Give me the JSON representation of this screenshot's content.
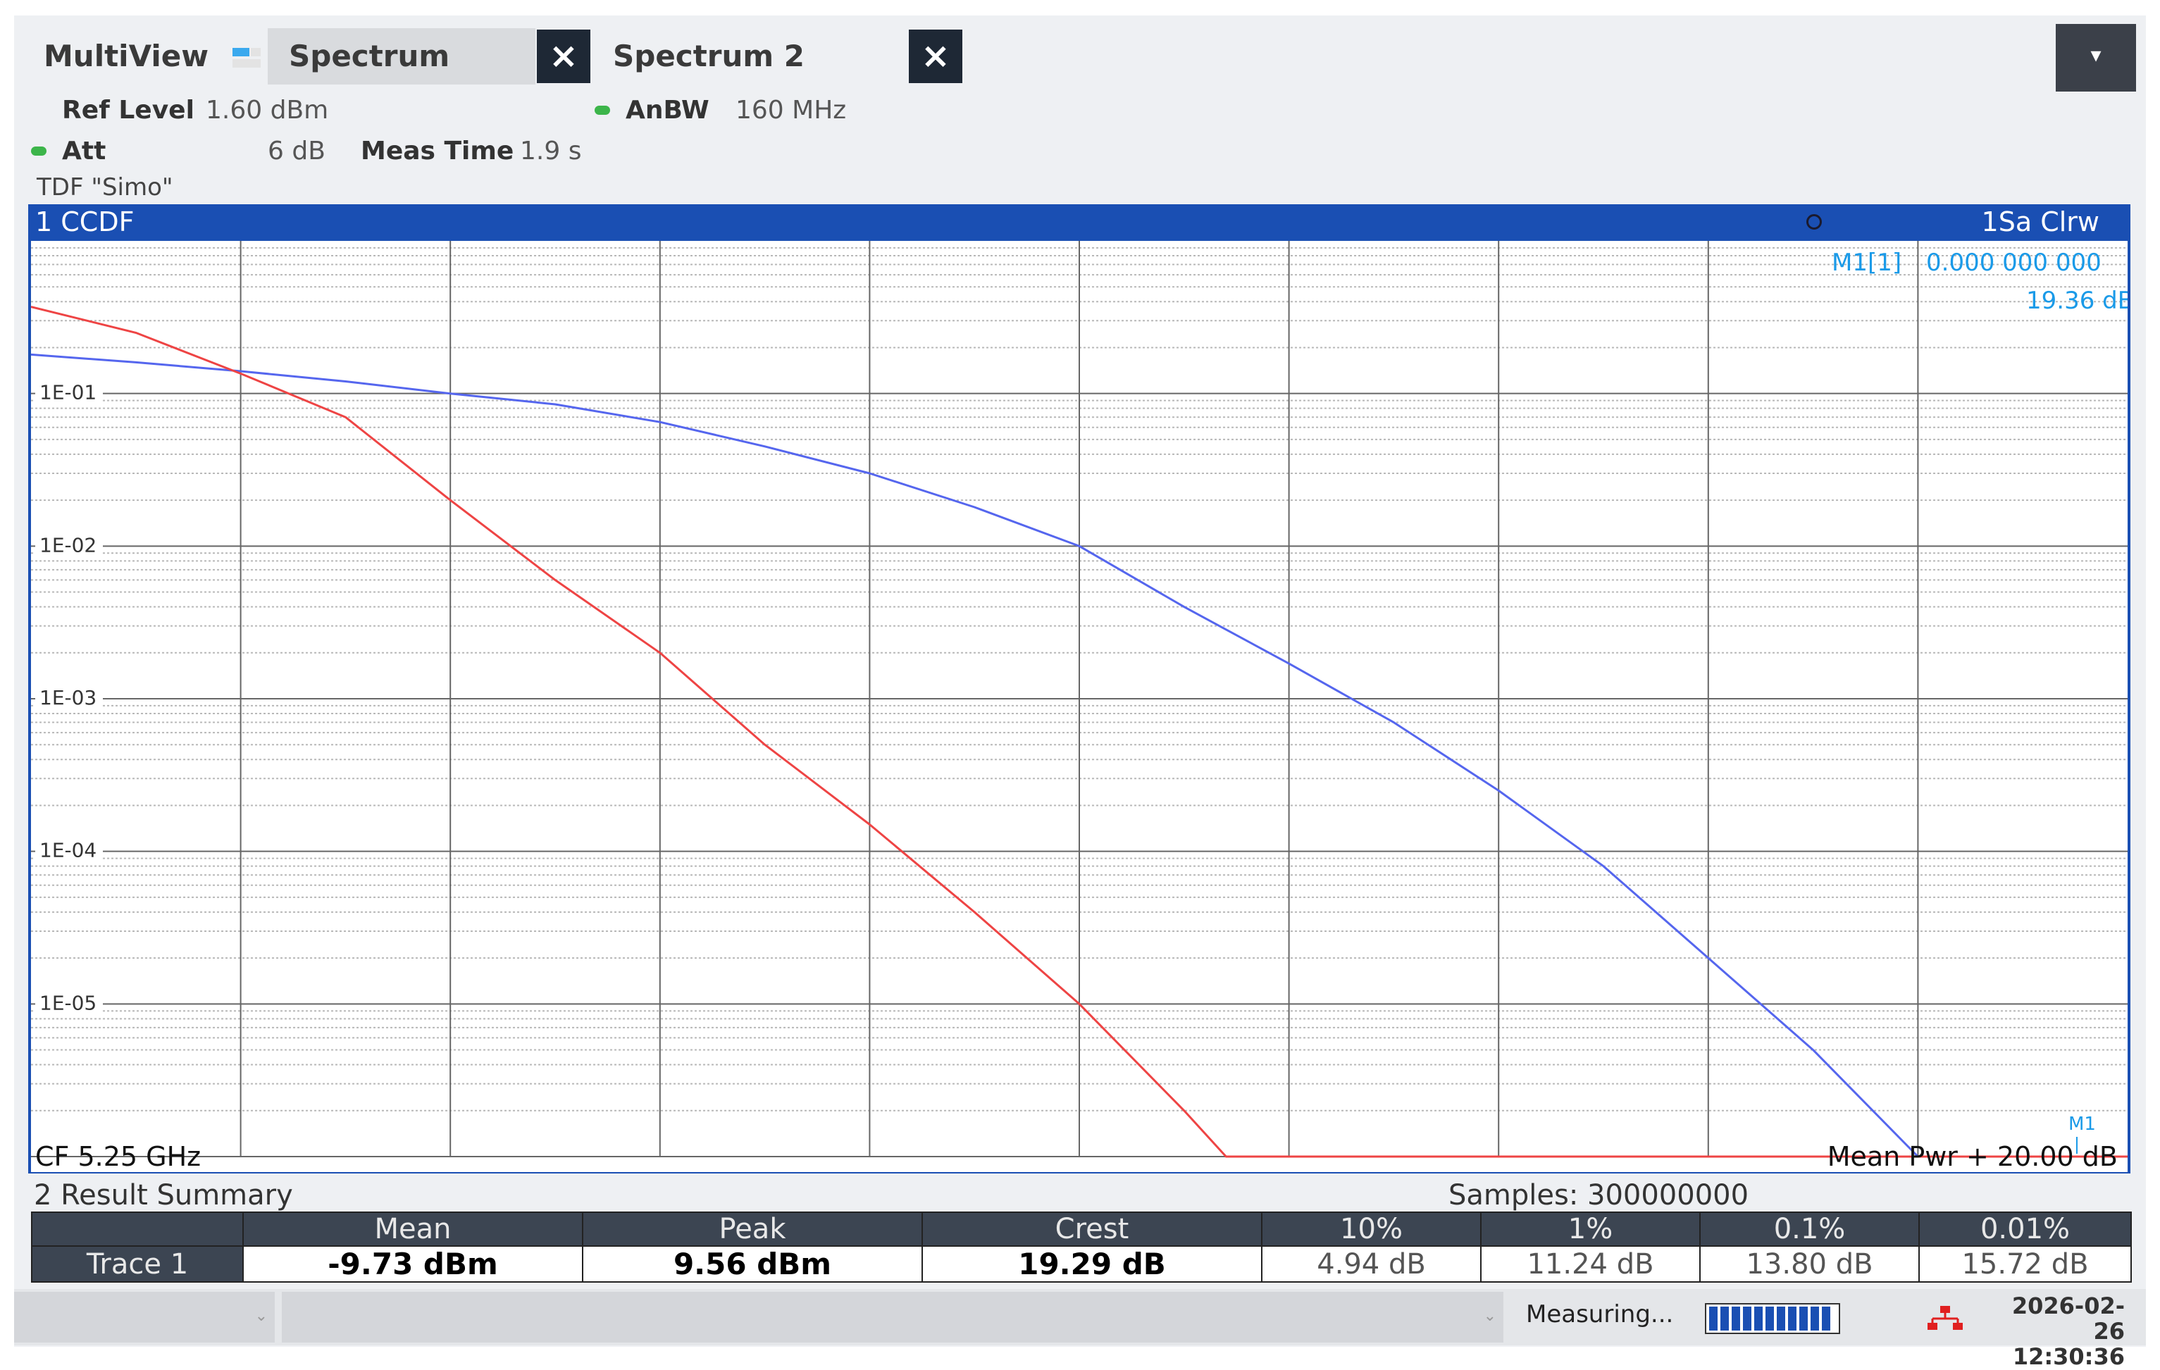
{
  "tabs": {
    "multiview": "MultiView",
    "spectrum": "Spectrum",
    "spectrum2": "Spectrum 2",
    "close_icon": "×",
    "menu_icon": "▾"
  },
  "settings": {
    "ref_level_label": "Ref Level",
    "ref_level_value": "1.60 dBm",
    "att_label": "Att",
    "att_value": "6 dB",
    "meas_time_label": "Meas Time",
    "meas_time_value": "1.9 s",
    "anbw_label": "AnBW",
    "anbw_value": "160 MHz",
    "tdf": "TDF \"Simo\""
  },
  "diagram": {
    "title": "1 CCDF",
    "trace_info": "1Sa Clrw",
    "marker_name": "M1[1]",
    "marker_value1": "0.000 000 000",
    "marker_value2": "19.36 dB",
    "marker_flag": "M1",
    "cf": "CF 5.25 GHz",
    "mean_pwr": "Mean Pwr + 20.00 dB"
  },
  "colors": {
    "header_blue": "#1a4fb3",
    "trace_blue": "#5566ee",
    "reference_red": "#ee4444",
    "marker_cyan": "#1a9ae8"
  },
  "chart_data": {
    "type": "line",
    "title": "1 CCDF",
    "xlabel": "",
    "ylabel": "",
    "xlim": [
      0,
      20
    ],
    "ylim": [
      1e-06,
      1
    ],
    "yscale": "log",
    "yticks": [
      "1E-01",
      "1E-02",
      "1E-03",
      "1E-04",
      "1E-05"
    ],
    "grid": true,
    "series": [
      {
        "color": "#5566ee",
        "x": [
          0,
          1,
          2,
          3,
          4,
          5,
          6,
          7,
          8,
          9,
          10,
          11,
          12,
          13,
          14,
          15,
          16,
          17,
          18
        ],
        "y": [
          0.18,
          0.16,
          0.14,
          0.12,
          0.1,
          0.085,
          0.065,
          0.045,
          0.03,
          0.018,
          0.01,
          0.004,
          0.0017,
          0.0007,
          0.00025,
          8e-05,
          2e-05,
          5e-06,
          1e-06
        ]
      },
      {
        "color": "#ee4444",
        "x": [
          0,
          1,
          2,
          3,
          4,
          5,
          6,
          7,
          8,
          9,
          10,
          11,
          11.4
        ],
        "y": [
          0.37,
          0.25,
          0.135,
          0.07,
          0.02,
          0.006,
          0.002,
          0.0005,
          0.00015,
          4e-05,
          1e-05,
          2e-06,
          1e-06
        ]
      }
    ]
  },
  "results": {
    "title": "2 Result Summary",
    "samples": "Samples: 300000000",
    "headers": [
      "",
      "Mean",
      "Peak",
      "Crest",
      "10%",
      "1%",
      "0.1%",
      "0.01%"
    ],
    "row": [
      "Trace 1",
      "-9.73 dBm",
      "9.56 dBm",
      "19.29 dB",
      "4.94 dB",
      "11.24 dB",
      "13.80 dB",
      "15.72 dB"
    ]
  },
  "status": {
    "measuring": "Measuring...",
    "date": "2026-02-26",
    "time": "12:30:36",
    "dropdown_arrow": "⌄"
  }
}
